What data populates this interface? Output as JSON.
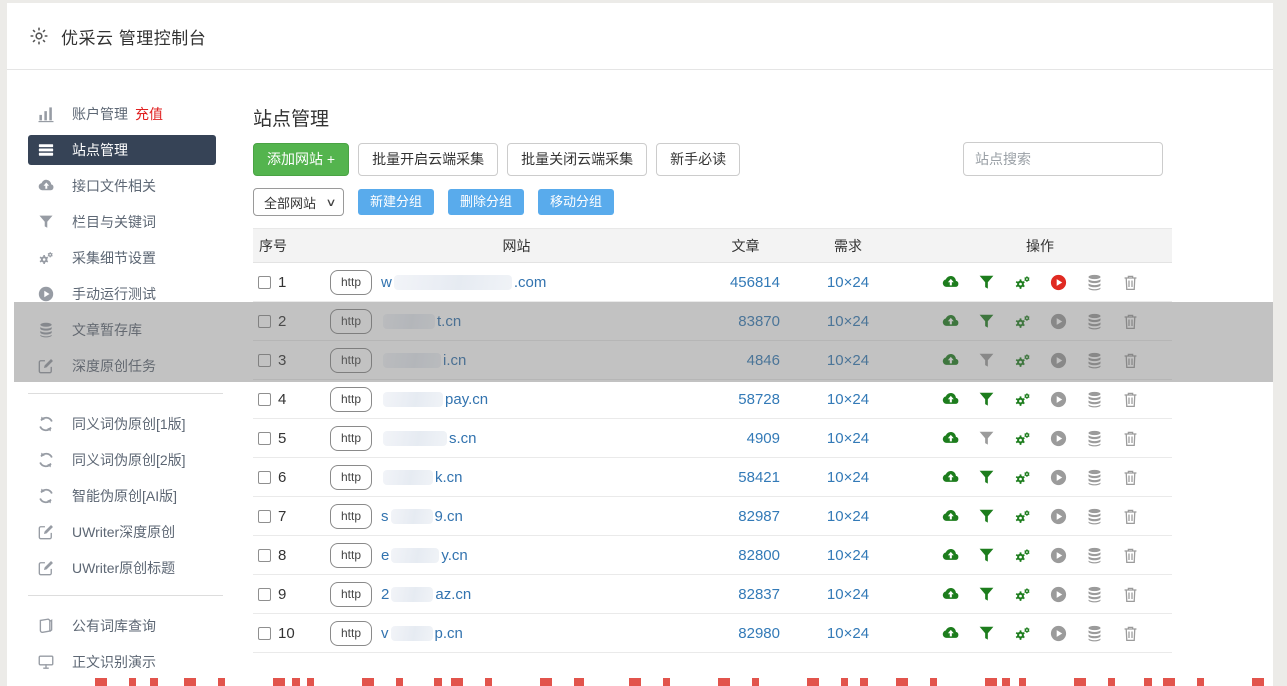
{
  "header": {
    "title": "优采云 管理控制台"
  },
  "sidebar": {
    "groups": [
      {
        "items": [
          {
            "key": "account",
            "icon": "chart",
            "label": "账户管理",
            "extra": "充值"
          },
          {
            "key": "sites",
            "icon": "list",
            "label": "站点管理",
            "active": true
          },
          {
            "key": "api-files",
            "icon": "cloud-up",
            "label": "接口文件相关"
          },
          {
            "key": "columns-keywords",
            "icon": "funnel",
            "label": "栏目与关键词"
          },
          {
            "key": "collect-settings",
            "icon": "gears",
            "label": "采集细节设置"
          },
          {
            "key": "manual-test",
            "icon": "play",
            "label": "手动运行测试"
          },
          {
            "key": "article-store",
            "icon": "database",
            "label": "文章暂存库"
          },
          {
            "key": "deep-original",
            "icon": "edit",
            "label": "深度原创任务"
          }
        ]
      },
      {
        "items": [
          {
            "key": "synonym-v1",
            "icon": "refresh",
            "label": "同义词伪原创[1版]"
          },
          {
            "key": "synonym-v2",
            "icon": "refresh",
            "label": "同义词伪原创[2版]"
          },
          {
            "key": "ai-rewrite",
            "icon": "refresh",
            "label": "智能伪原创[AI版]"
          },
          {
            "key": "uwriter-deep",
            "icon": "edit",
            "label": "UWriter深度原创"
          },
          {
            "key": "uwriter-title",
            "icon": "edit",
            "label": "UWriter原创标题"
          }
        ]
      },
      {
        "items": [
          {
            "key": "thesaurus",
            "icon": "book",
            "label": "公有词库查询"
          },
          {
            "key": "content-demo",
            "icon": "monitor",
            "label": "正文识别演示"
          }
        ]
      }
    ]
  },
  "main": {
    "title": "站点管理",
    "toolbar": {
      "add_site": "添加网站 +",
      "batch_open": "批量开启云端采集",
      "batch_close": "批量关闭云端采集",
      "newbie": "新手必读",
      "search_placeholder": "站点搜索"
    },
    "group_bar": {
      "select_value": "全部网站",
      "new_group": "新建分组",
      "delete_group": "删除分组",
      "move_group": "移动分组"
    },
    "table": {
      "columns": [
        "序号",
        "网站",
        "文章",
        "需求",
        "操作"
      ],
      "http_label": "http",
      "rows": [
        {
          "num": "1",
          "domain_prefix": "w",
          "domain_suffix": ".com",
          "redact_width": 118,
          "articles": "456814",
          "demand": "10×24",
          "funnel": "green",
          "play": "red"
        },
        {
          "num": "2",
          "domain_prefix": "",
          "domain_suffix": "t.cn",
          "redact_width": 52,
          "articles": "83870",
          "demand": "10×24",
          "funnel": "green",
          "play": "gray"
        },
        {
          "num": "3",
          "domain_prefix": "",
          "domain_suffix": "i.cn",
          "redact_width": 58,
          "articles": "4846",
          "demand": "10×24",
          "funnel": "gray",
          "play": "gray"
        },
        {
          "num": "4",
          "domain_prefix": "",
          "domain_suffix": "pay.cn",
          "redact_width": 60,
          "articles": "58728",
          "demand": "10×24",
          "funnel": "green",
          "play": "gray"
        },
        {
          "num": "5",
          "domain_prefix": "",
          "domain_suffix": "s.cn",
          "redact_width": 64,
          "articles": "4909",
          "demand": "10×24",
          "funnel": "gray",
          "play": "gray"
        },
        {
          "num": "6",
          "domain_prefix": "",
          "domain_suffix": "k.cn",
          "redact_width": 50,
          "articles": "58421",
          "demand": "10×24",
          "funnel": "green",
          "play": "gray"
        },
        {
          "num": "7",
          "domain_prefix": "s",
          "domain_suffix": "9.cn",
          "redact_width": 42,
          "articles": "82987",
          "demand": "10×24",
          "funnel": "green",
          "play": "gray"
        },
        {
          "num": "8",
          "domain_prefix": "e",
          "domain_suffix": "y.cn",
          "redact_width": 48,
          "articles": "82800",
          "demand": "10×24",
          "funnel": "green",
          "play": "gray"
        },
        {
          "num": "9",
          "domain_prefix": "2",
          "domain_suffix": "az.cn",
          "redact_width": 42,
          "articles": "82837",
          "demand": "10×24",
          "funnel": "green",
          "play": "gray"
        },
        {
          "num": "10",
          "domain_prefix": "v",
          "domain_suffix": "p.cn",
          "redact_width": 42,
          "articles": "82980",
          "demand": "10×24",
          "funnel": "green",
          "play": "gray"
        }
      ]
    }
  },
  "colors": {
    "accent_green": "#54b44e",
    "accent_blue": "#59abec",
    "link_blue": "#337ab7",
    "icon_green": "#1d7d1d",
    "icon_gray": "#9b9b9b",
    "icon_red": "#e02a22",
    "sidebar_active_bg": "#364356",
    "recharge_red": "#e02020"
  }
}
